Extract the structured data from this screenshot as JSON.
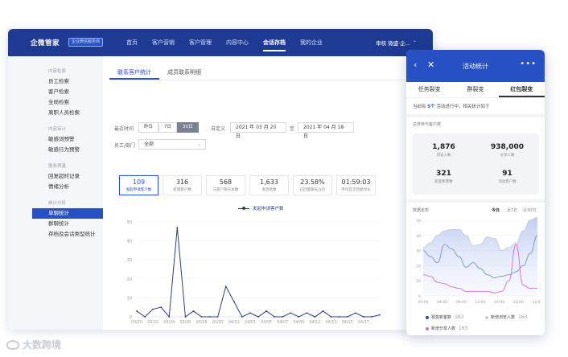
{
  "app": {
    "logo": "企微管家",
    "badge": "企业微信服务商",
    "nav": [
      "首页",
      "客户营销",
      "客户管理",
      "内容中心",
      "会话存档",
      "我的企业"
    ],
    "nav_active": 4,
    "user": "审核 微盛·企..."
  },
  "sidebar": {
    "groups": [
      {
        "title": "内容检索",
        "items": [
          "员工检索",
          "客户检索",
          "全局检索",
          "离职人员检索"
        ]
      },
      {
        "title": "内容审计",
        "items": [
          "敏感词预警",
          "敏感行为预警"
        ]
      },
      {
        "title": "服务质量",
        "items": [
          "回复超时记录",
          "情绪分析"
        ]
      },
      {
        "title": "统计分析",
        "items": [
          "单聊统计",
          "群聊统计",
          "存档及会话类型统计"
        ]
      }
    ],
    "active": "单聊统计"
  },
  "content": {
    "tabs": [
      "联系客户统计",
      "成员联系明细"
    ],
    "filter": {
      "time_label": "最近时间",
      "ranges": [
        "昨日",
        "7日",
        "30日"
      ],
      "range_active": 2,
      "custom_label": "自定义",
      "date_from": "2021 年 03 月 20 日",
      "to": "至",
      "date_to": "2021 年 04 月 18 日",
      "dept_label": "员工/部门",
      "dept_value": "全部"
    },
    "stats": [
      {
        "value": "109",
        "label": "发起申请客户数"
      },
      {
        "value": "316",
        "label": "新增客户数"
      },
      {
        "value": "568",
        "label": "与客户聊天总数"
      },
      {
        "value": "1,633",
        "label": "发消息数"
      },
      {
        "value": "23.58%",
        "label": "已回复聊天占比"
      },
      {
        "value": "01:59:03",
        "label": "平均首次回复时长"
      }
    ]
  },
  "chart_data": {
    "type": "line",
    "series": [
      {
        "name": "发起申请客户数",
        "values": [
          3,
          0,
          4,
          5,
          0,
          47,
          0,
          3,
          0,
          0,
          0,
          16,
          8,
          0,
          2,
          0,
          3,
          0,
          0,
          2,
          0,
          2,
          0,
          3,
          0,
          0,
          0,
          2,
          0,
          0,
          1
        ]
      }
    ],
    "x": [
      "03/20",
      "03/21",
      "03/22",
      "03/23",
      "03/24",
      "03/25",
      "03/26",
      "03/27",
      "03/28",
      "03/29",
      "03/30",
      "03/31",
      "04/01",
      "04/02",
      "04/03",
      "04/04",
      "04/05",
      "04/06",
      "04/07",
      "04/08",
      "04/09",
      "04/10",
      "04/11",
      "04/12",
      "04/13",
      "04/14",
      "04/15",
      "04/16",
      "04/17",
      "04/18",
      "04/19"
    ],
    "xticks": [
      "03/20",
      "03/22",
      "03/24",
      "03/26",
      "03/28",
      "03/30",
      "04/01",
      "04/03",
      "04/05",
      "04/07",
      "04/09",
      "04/11",
      "04/13",
      "04/15",
      "04/17"
    ],
    "yticks": [
      0,
      10,
      20,
      30,
      40,
      50
    ],
    "ylim": [
      0,
      50
    ],
    "color": "#2c3e7a"
  },
  "phone": {
    "title": "活动统计",
    "tabs": [
      "任务裂变",
      "群裂变",
      "红包裂变"
    ],
    "tab_active": 2,
    "note_pre": "当前有",
    "note_count": "5个",
    "note_post": "活动进行中，相关统计如下",
    "summary_title": "总体参与客户数",
    "metrics": [
      {
        "value": "1,876",
        "label": "浏览人数"
      },
      {
        "value": "938,000",
        "label": "分享人数"
      },
      {
        "value": "321",
        "label": "裂变新客数"
      },
      {
        "value": "91",
        "label": "活动客户数"
      }
    ],
    "trend_title": "数据走势",
    "ranges": [
      "今日",
      "近7日",
      "近30日"
    ],
    "range_active": 0,
    "trend_chart": {
      "type": "area",
      "x": [
        "00:00",
        "04:00",
        "08:00",
        "12:00",
        "16:00",
        "20:00",
        "24:00"
      ],
      "yticks": [
        0,
        10,
        20,
        30,
        40,
        50
      ],
      "ylim": [
        0,
        50
      ],
      "series": [
        {
          "name": "裂变新客数",
          "color": "#4a78c8",
          "values": [
            30,
            26,
            22,
            34,
            31,
            26,
            19,
            22,
            18,
            14,
            12,
            13,
            14,
            16,
            20,
            28,
            40
          ]
        },
        {
          "name": "新增浏览人数",
          "color": "#c8c8d0",
          "values": [
            32,
            35,
            40,
            43,
            44,
            44,
            40,
            33,
            34,
            39,
            38,
            30,
            32,
            35,
            43,
            50,
            52
          ]
        },
        {
          "name": "新增分享人数",
          "color": "#d070d8",
          "values": [
            14,
            13,
            9,
            8,
            6,
            5,
            3,
            3,
            3,
            3,
            2,
            3,
            10,
            34,
            7,
            5,
            5
          ]
        }
      ],
      "legend": [
        {
          "name": "裂变新客数",
          "value": "163"
        },
        {
          "name": "新增浏览人数",
          "value": "163"
        },
        {
          "name": "新增分享人数",
          "value": "163"
        }
      ]
    }
  },
  "watermark": "大数跨境",
  "colors": {
    "brand": "#1f3a93",
    "accent": "#2750c4",
    "line": "#2c3e7a"
  }
}
